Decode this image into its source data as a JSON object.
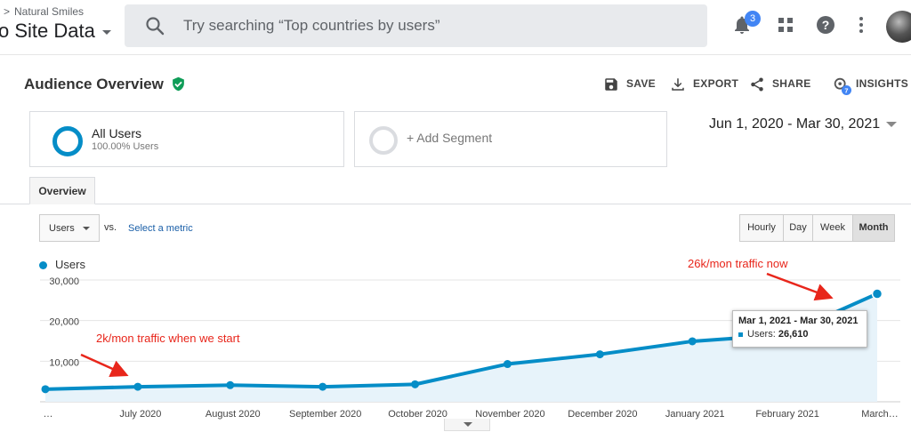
{
  "header": {
    "breadcrumb": "Natural Smiles",
    "view_name": "o Site Data",
    "search_placeholder": "Try searching “Top countries by users”",
    "notification_count": "3"
  },
  "report": {
    "title": "Audience Overview",
    "actions": {
      "save": "SAVE",
      "export": "EXPORT",
      "share": "SHARE",
      "insights": "INSIGHTS",
      "insights_badge": "7"
    }
  },
  "segments": {
    "all_users": {
      "name": "All Users",
      "sub": "100.00% Users"
    },
    "add_label": "+ Add Segment"
  },
  "date_range": "Jun 1, 2020 - Mar 30, 2021",
  "tabs": [
    "Overview"
  ],
  "controls": {
    "metric": "Users",
    "vs": "vs.",
    "select_metric": "Select a metric",
    "granularity": [
      "Hourly",
      "Day",
      "Week",
      "Month"
    ],
    "active_granularity": "Month"
  },
  "legend": {
    "series": "Users"
  },
  "tooltip": {
    "title": "Mar 1, 2021 - Mar 30, 2021",
    "label": "Users:",
    "value": "26,610"
  },
  "annotations": {
    "start": "2k/mon traffic when we start",
    "now": "26k/mon traffic now"
  },
  "colors": {
    "series": "#058dc7",
    "annotation": "#e8261b",
    "brand": "#4285f4"
  },
  "chart_data": {
    "type": "area",
    "title": "",
    "xlabel": "",
    "ylabel": "",
    "categories": [
      "…",
      "July 2020",
      "August 2020",
      "September 2020",
      "October 2020",
      "November 2020",
      "December 2020",
      "January 2021",
      "February 2021",
      "March…"
    ],
    "series": [
      {
        "name": "Users",
        "values": [
          3100,
          3700,
          4100,
          3700,
          4300,
          9300,
          11700,
          14900,
          16500,
          26610
        ]
      }
    ],
    "ylim": [
      0,
      30000
    ],
    "yticks": [
      10000,
      20000,
      30000
    ],
    "ytick_labels": [
      "10,000",
      "20,000",
      "30,000"
    ],
    "grid": true
  }
}
